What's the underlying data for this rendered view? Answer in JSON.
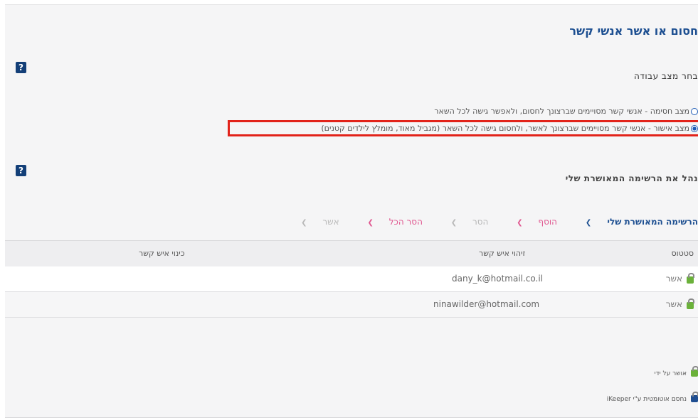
{
  "page": {
    "title": "חסום או אשר אנשי קשר",
    "help_label": "?"
  },
  "work_mode": {
    "heading": "בחר מצב עבודה",
    "options": [
      {
        "label": "מצב חסימה - אנשי קשר מסויימים שברצונך לחסום, ולאפשר גישה לכל השאר",
        "selected": false
      },
      {
        "label": "מצב אישור - אנשי קשר מסויימים שברצונך לאשר, ולחסום גישה לכל השאר (מגביל מאוד, מומלץ לילדים קטנים)",
        "selected": true
      }
    ]
  },
  "approved_list": {
    "heading": "נהל את הרשימה המאושרת שלי",
    "actions": {
      "my_list": "הרשימה המאושרת שלי",
      "add": "הוסף",
      "remove": "הסר",
      "remove_all": "הסר הכל",
      "approve": "אשר"
    },
    "columns": {
      "status": "סטטוס",
      "contact_id": "זיהוי איש קשר",
      "contact_nick": "כינוי איש קשר"
    },
    "rows": [
      {
        "status": "אשר",
        "contact_id": "dany_k@hotmail.co.il",
        "contact_nick": ""
      },
      {
        "status": "אשר",
        "contact_id": "ninawilder@hotmail.com",
        "contact_nick": ""
      }
    ]
  },
  "legend": {
    "approved_by": "אושר על ידי",
    "auto_blocked": "נחסם אוטומטית ע\"י iKeeper"
  },
  "colors": {
    "brand_blue": "#1d4f91",
    "highlight_red": "#e2231a",
    "lock_green": "#6bb13a",
    "lock_blue": "#1f4e91",
    "action_pink": "#e0568f"
  }
}
